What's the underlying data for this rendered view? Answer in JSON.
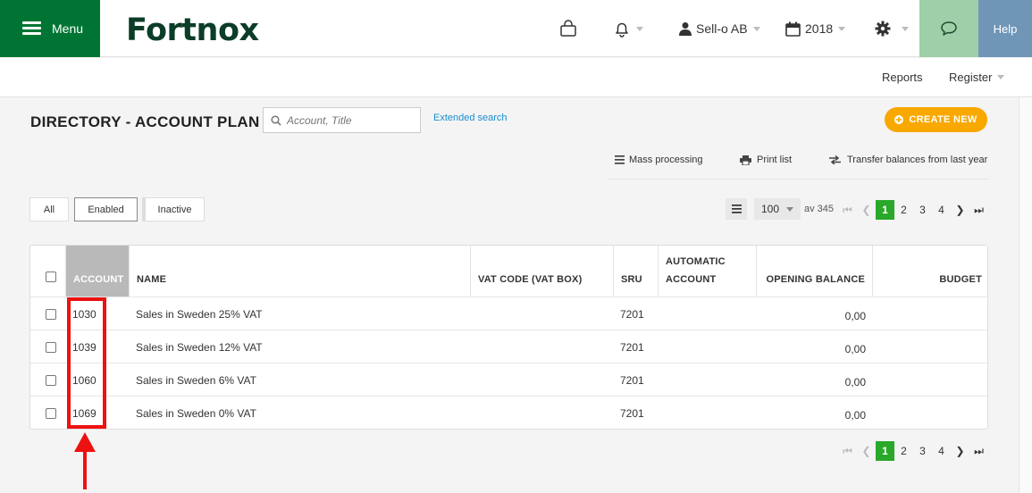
{
  "topbar": {
    "menu_label": "Menu",
    "logo": "Fortnox",
    "company": "Sell-o AB",
    "year": "2018",
    "help_label": "Help",
    "colors": {
      "menu_bg": "#007533",
      "chat_bg": "#9fcfa8",
      "help_bg": "#6f96b7"
    }
  },
  "subnav": {
    "reports": "Reports",
    "register": "Register"
  },
  "page": {
    "title": "DIRECTORY - ACCOUNT PLAN",
    "search_placeholder": "Account, Title",
    "extended_search": "Extended search",
    "create_new": "CREATE NEW"
  },
  "actions": {
    "mass_processing": "Mass processing",
    "print_list": "Print list",
    "transfer": "Transfer balances from last year"
  },
  "filters": {
    "all": "All",
    "enabled": "Enabled",
    "inactive": "Inactive",
    "selected": "Enabled"
  },
  "pagination": {
    "per_page": "100",
    "total_label": "av 345",
    "pages": [
      "1",
      "2",
      "3",
      "4"
    ],
    "current": "1"
  },
  "table": {
    "headers": {
      "account": "ACCOUNT",
      "name": "NAME",
      "vat_code": "VAT CODE (VAT BOX)",
      "sru": "SRU",
      "automatic_line1": "AUTOMATIC",
      "automatic_line2": "ACCOUNT",
      "opening_balance": "OPENING BALANCE",
      "budget": "BUDGET"
    },
    "rows": [
      {
        "account": "1030",
        "name": "Sales in Sweden 25% VAT",
        "sru": "7201",
        "opening_balance": "0,00"
      },
      {
        "account": "1039",
        "name": "Sales in Sweden 12% VAT",
        "sru": "7201",
        "opening_balance": "0,00"
      },
      {
        "account": "1060",
        "name": "Sales in Sweden 6% VAT",
        "sru": "7201",
        "opening_balance": "0,00"
      },
      {
        "account": "1069",
        "name": "Sales in Sweden 0% VAT",
        "sru": "7201",
        "opening_balance": "0,00"
      }
    ]
  },
  "annotation": {
    "color": "#ee1111"
  }
}
